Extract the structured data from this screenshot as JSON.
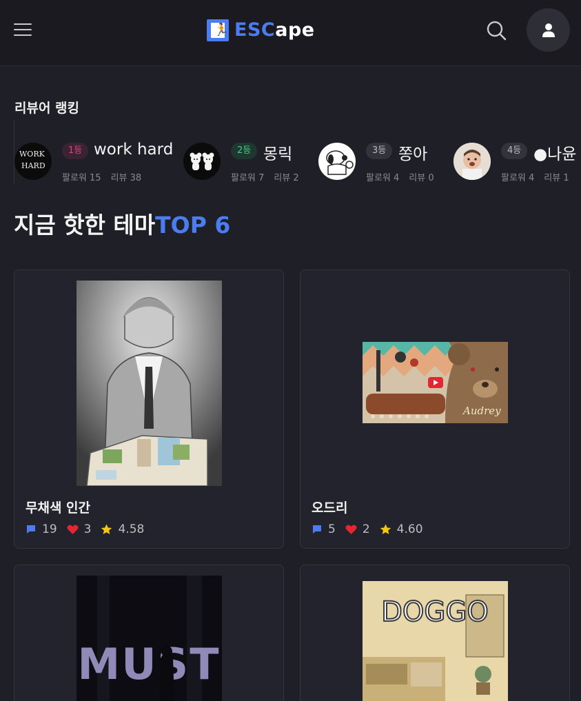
{
  "header": {
    "logo_esc": "ESC",
    "logo_ape": "ape"
  },
  "ranking": {
    "label": "리뷰어 랭킹",
    "items": [
      {
        "rank": "1등",
        "name": "work hard",
        "followers": "팔로워 15",
        "reviews": "리뷰 38",
        "avatar_text_1": "WORK",
        "avatar_text_2": "HARD",
        "badge_color": "#e0457b"
      },
      {
        "rank": "2등",
        "name": "몽릭",
        "followers": "팔로워 7",
        "reviews": "리뷰 2",
        "badge_color": "#3ecf8e"
      },
      {
        "rank": "3등",
        "name": "쫑아",
        "followers": "팔로워 4",
        "reviews": "리뷰 0",
        "badge_color": "#b9b9c2"
      },
      {
        "rank": "4등",
        "name": "●나윤",
        "followers": "팔로워 4",
        "reviews": "리뷰 1",
        "badge_color": "#b9b9c2"
      }
    ]
  },
  "hot": {
    "title_main": "지금 핫한 테마",
    "title_accent": "TOP 6",
    "cards": [
      {
        "title": "무채색 인간",
        "comments": "19",
        "likes": "3",
        "rating": "4.58"
      },
      {
        "title": "오드리",
        "comments": "5",
        "likes": "2",
        "rating": "4.60",
        "poster_text": "Audrey"
      },
      {
        "title": "",
        "poster_text": "MUST"
      },
      {
        "title": "",
        "poster_text": "DOGGO"
      }
    ]
  },
  "colors": {
    "accent": "#4c7df0",
    "background": "#1f1f27",
    "card": "#23232d",
    "heart": "#e5252f",
    "star": "#f5c518"
  },
  "icons": [
    "menu-icon",
    "search-icon",
    "user-icon",
    "comment-icon",
    "heart-icon",
    "star-icon",
    "play-icon"
  ]
}
